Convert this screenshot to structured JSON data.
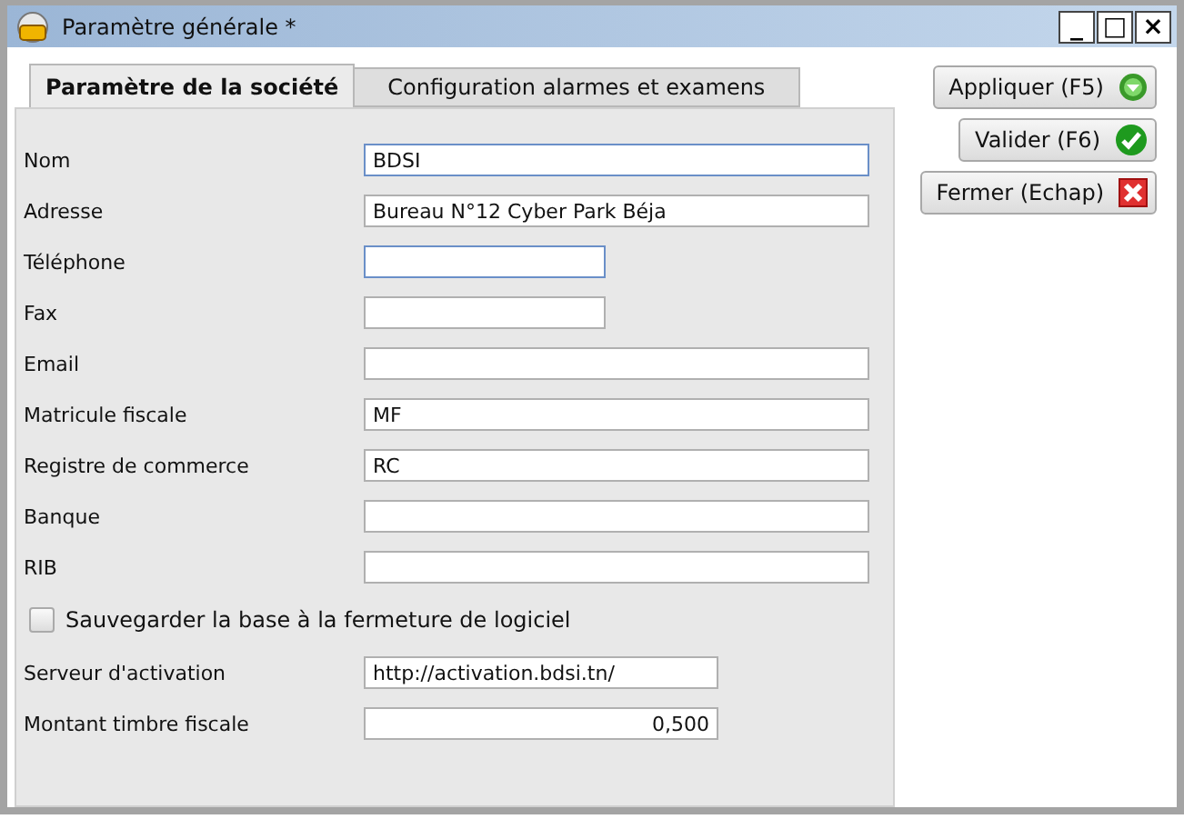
{
  "window": {
    "title": "Paramètre générale *",
    "controls": [
      "_",
      "□",
      "×"
    ]
  },
  "tabs": [
    {
      "label": "Paramètre de la société",
      "selected": true
    },
    {
      "label": "Configuration alarmes et examens",
      "selected": false
    }
  ],
  "fields": [
    {
      "label": "Nom",
      "value": "BDSI",
      "kind": "long",
      "highlighted": true
    },
    {
      "label": "Adresse",
      "value": "Bureau N°12 Cyber Park Béja",
      "kind": "long",
      "highlighted": false
    },
    {
      "label": "Téléphone",
      "kind": "short",
      "highlighted": true
    },
    {
      "label": "Fax",
      "kind": "short",
      "highlighted": false
    },
    {
      "label": "Email",
      "kind": "long",
      "highlighted": false
    },
    {
      "label": "Matricule fiscale",
      "value": "MF",
      "kind": "long",
      "highlighted": false
    },
    {
      "label": "Registre de commerce",
      "value": "RC",
      "kind": "long",
      "highlighted": false
    },
    {
      "label": "Banque",
      "kind": "long",
      "highlighted": false
    },
    {
      "label": "RIB",
      "kind": "long",
      "highlighted": false
    }
  ],
  "checkbox": {
    "label": "Sauvegarder la base à la fermeture de logiciel",
    "checked": false
  },
  "extra_fields": [
    {
      "label": "Serveur d'activation",
      "value": "http://activation.bdsi.tn/",
      "kind": "text"
    },
    {
      "label": "Montant timbre fiscale",
      "value": "0,500",
      "kind": "number"
    }
  ],
  "buttons": [
    {
      "label": "Appliquer (F5)",
      "kind": "apply"
    },
    {
      "label": "Valider (F6)",
      "kind": "validate"
    },
    {
      "label": "Fermer (Echap)",
      "kind": "close"
    }
  ]
}
